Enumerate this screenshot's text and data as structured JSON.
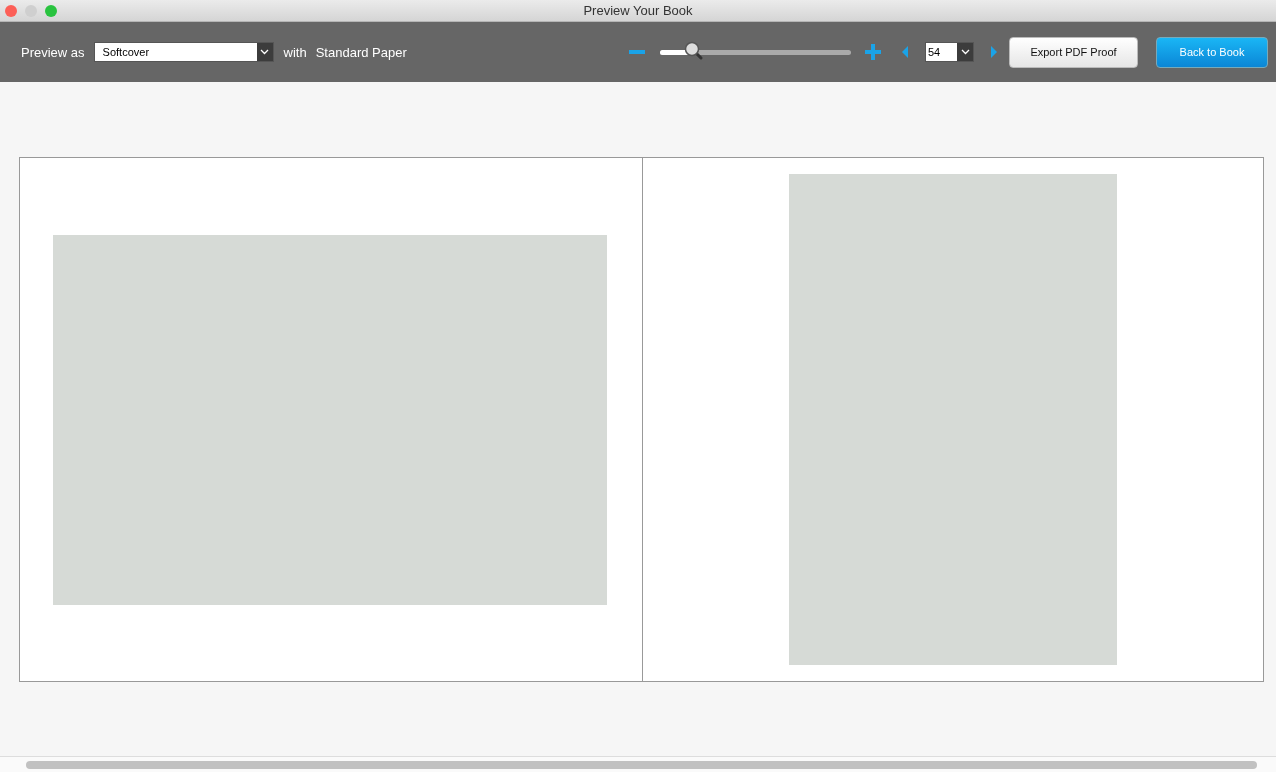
{
  "window": {
    "title": "Preview Your Book"
  },
  "toolbar": {
    "preview_label": "Preview as",
    "format_select": {
      "value": "Softcover"
    },
    "with_label": "with",
    "paper": "Standard Paper",
    "zoom": {
      "level": 0.17
    },
    "page_select": {
      "value": "54"
    },
    "export_button": "Export PDF Proof",
    "back_button": "Back to Book"
  },
  "spread": {
    "pages": [
      {
        "kind": "landscape"
      },
      {
        "kind": "portrait"
      }
    ]
  }
}
